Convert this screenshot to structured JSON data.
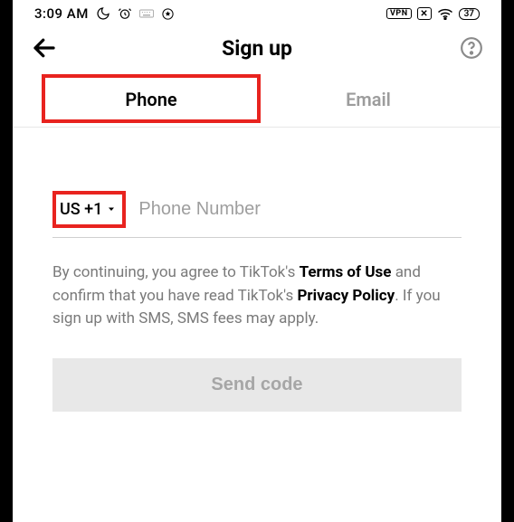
{
  "status": {
    "time": "3:09 AM",
    "vpn": "VPN",
    "battery": "37"
  },
  "header": {
    "title": "Sign up"
  },
  "tabs": {
    "phone": "Phone",
    "email": "Email"
  },
  "phone": {
    "country": "US +1",
    "placeholder": "Phone Number"
  },
  "legal": {
    "p1a": "By continuing, you agree to TikTok's ",
    "terms": "Terms of Use",
    "p1b": " and confirm that you have read TikTok's ",
    "privacy": "Privacy Policy",
    "p1c": ". If you sign up with SMS, SMS fees may apply."
  },
  "send": "Send code"
}
